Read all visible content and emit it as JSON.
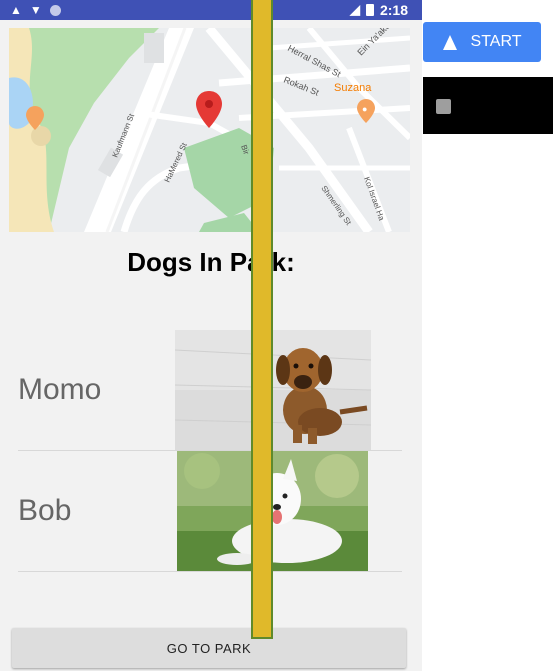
{
  "status_bar": {
    "time": "2:18",
    "background": "#3f51b5"
  },
  "map": {
    "streets": [
      "Herral Shas St",
      "Ein Ya'akov",
      "Rokah St",
      "Kaufmann St",
      "HaMered St",
      "Bir",
      "Shmerling St",
      "Kol Israel Ha"
    ],
    "place_label": "Suzana",
    "place_color": "#f57c00",
    "marker_color": "#e53935",
    "park_color": "#a5d6a7"
  },
  "dogs_section": {
    "title": "Dogs In Park:"
  },
  "dogs": [
    {
      "name": "Momo",
      "photo": "puppy-on-concrete"
    },
    {
      "name": "Bob",
      "photo": "white-dog-on-grass"
    }
  ],
  "actions": {
    "go_to_park": "GO TO PARK",
    "start": "START"
  },
  "overlay": {
    "fill": "#e0b92a",
    "border": "#5f8a2b"
  }
}
